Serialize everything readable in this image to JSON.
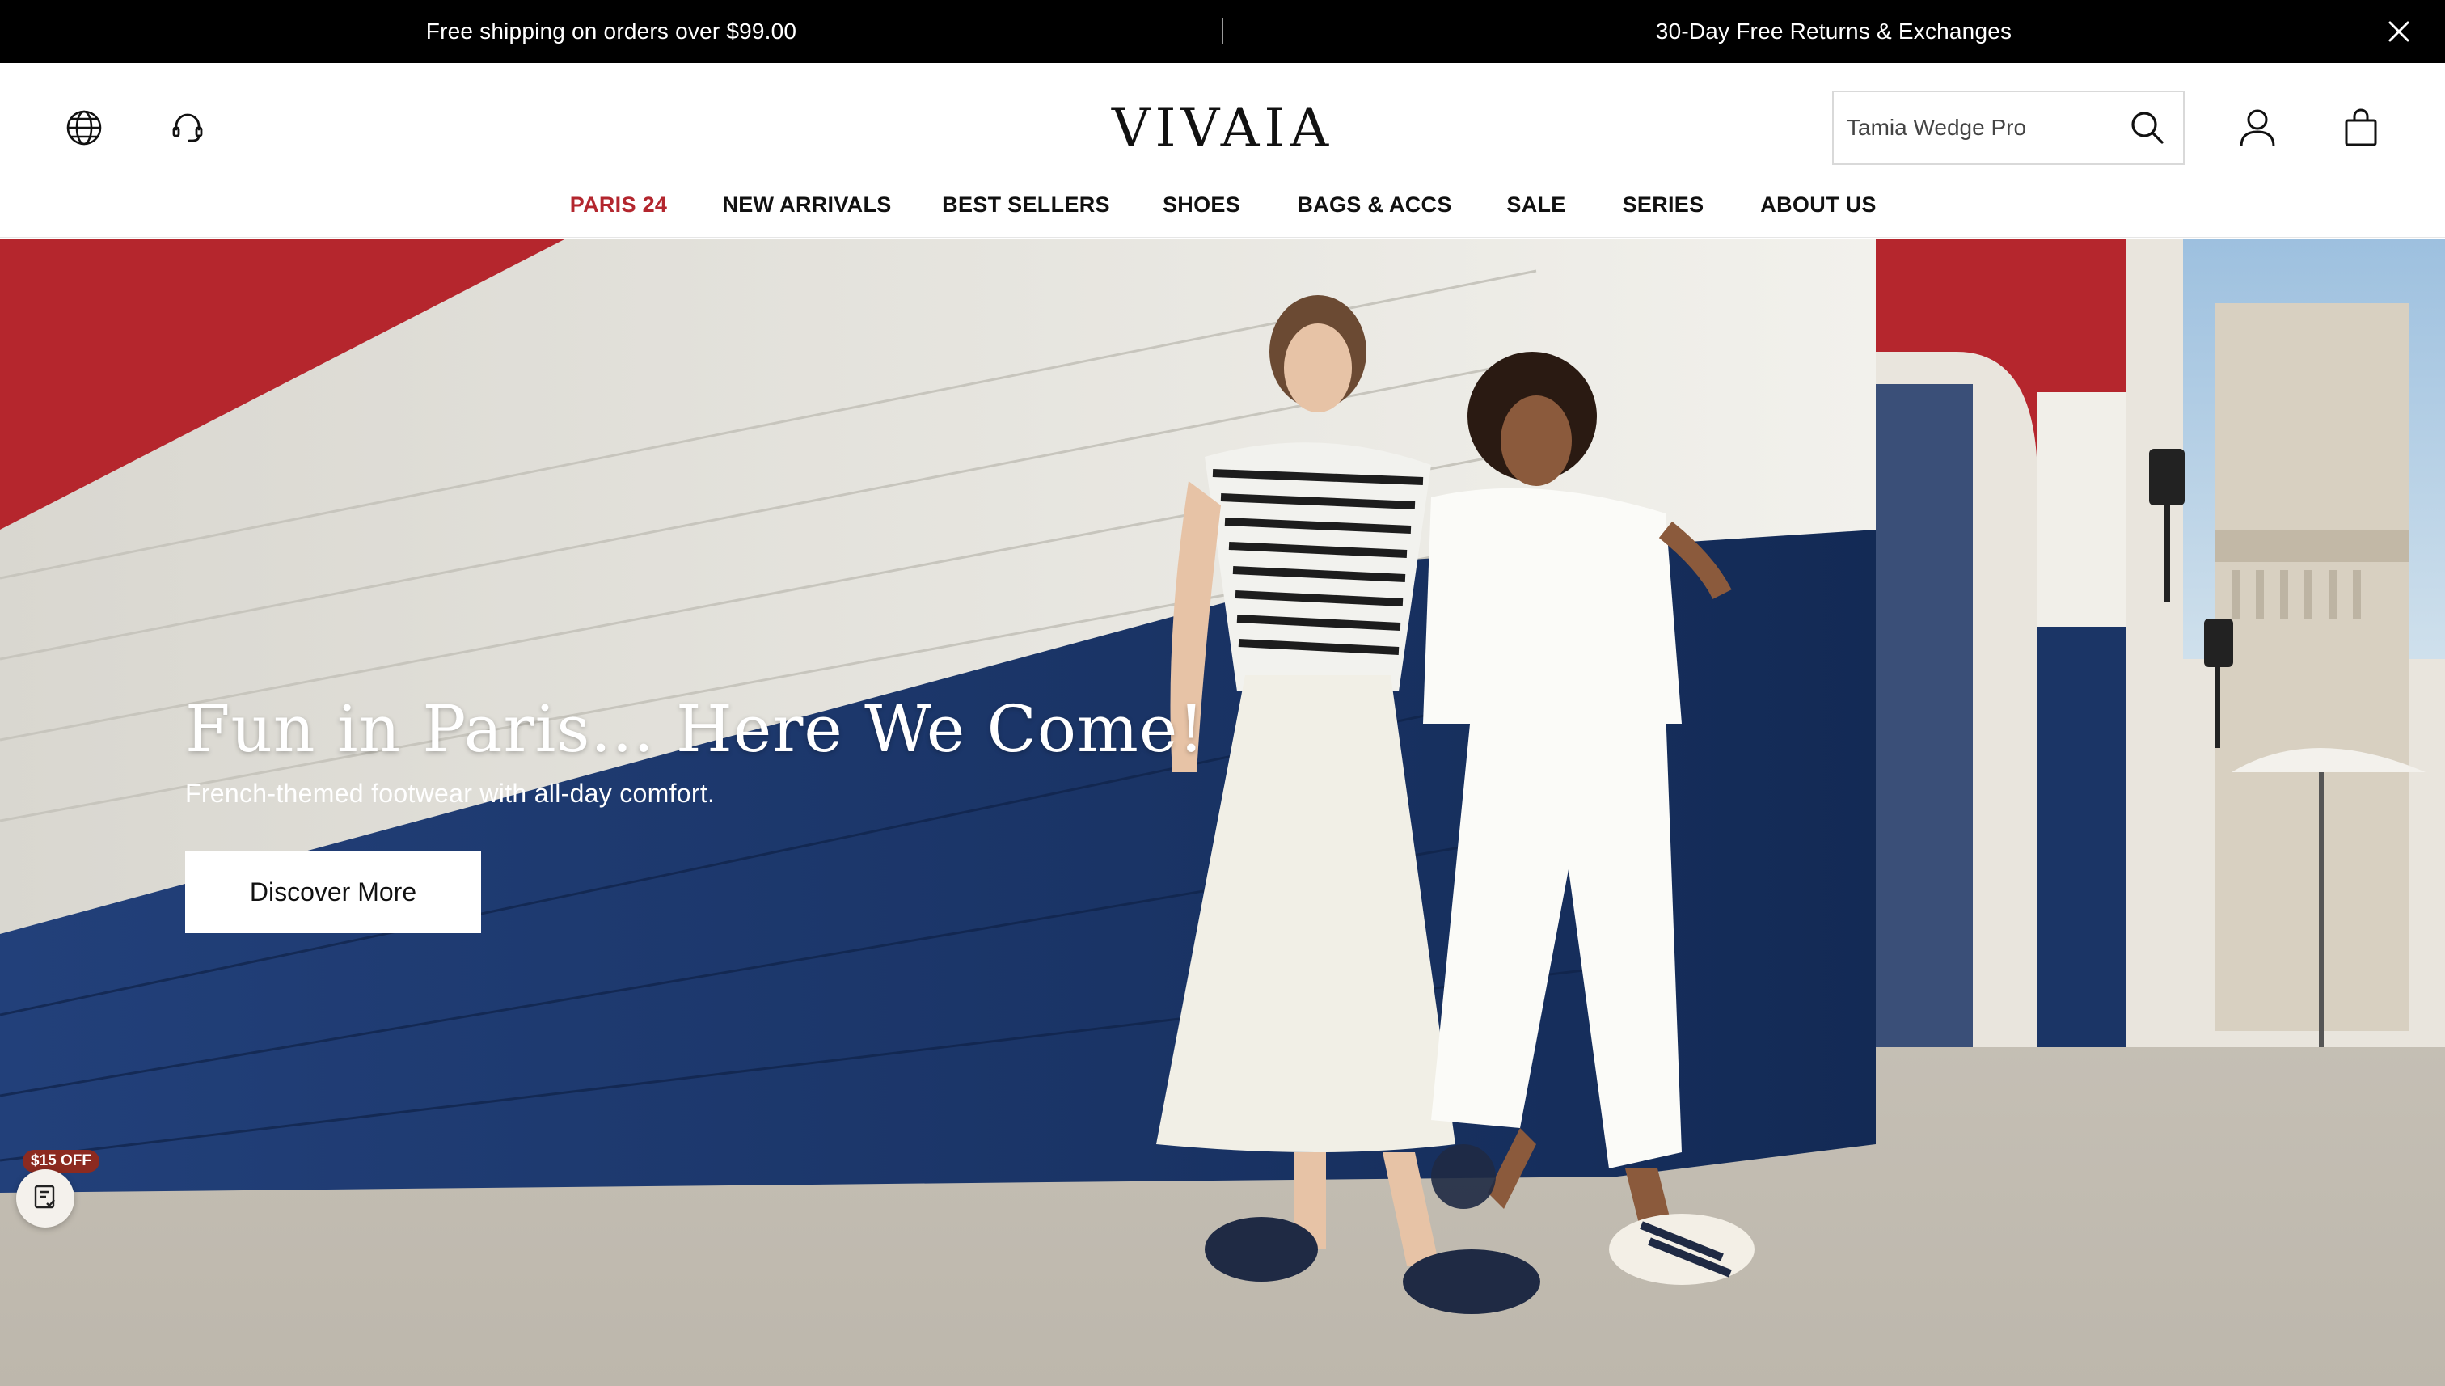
{
  "announcement": {
    "left_text": "Free shipping on orders over $99.00",
    "right_text": "30-Day Free Returns & Exchanges",
    "close_icon": "close-icon"
  },
  "header": {
    "logo": "VIVAIA",
    "search": {
      "value": "",
      "placeholder": "Tamia Wedge Pro"
    },
    "icons": [
      "globe-icon",
      "headset-icon",
      "search-icon",
      "user-icon",
      "bag-icon"
    ]
  },
  "nav": {
    "items": [
      {
        "label": "PARIS 24",
        "active": true
      },
      {
        "label": "NEW ARRIVALS",
        "active": false
      },
      {
        "label": "BEST SELLERS",
        "active": false
      },
      {
        "label": "SHOES",
        "active": false
      },
      {
        "label": "BAGS & ACCS",
        "active": false
      },
      {
        "label": "SALE",
        "active": false
      },
      {
        "label": "SERIES",
        "active": false
      },
      {
        "label": "ABOUT US",
        "active": false
      }
    ]
  },
  "hero": {
    "title": "Fun in Paris... Here We Come!",
    "subtitle": "French-themed footwear with all-day comfort.",
    "cta_label": "Discover More"
  },
  "coupon": {
    "badge": "$15 OFF",
    "icon": "coupon-icon"
  },
  "colors": {
    "accent": "#b3262e",
    "announcement_bg": "#000000",
    "wall_blue": "#1b3566",
    "wall_red": "#b5262d",
    "wall_white": "#ecebe6",
    "pavement": "#c9c4ba"
  }
}
